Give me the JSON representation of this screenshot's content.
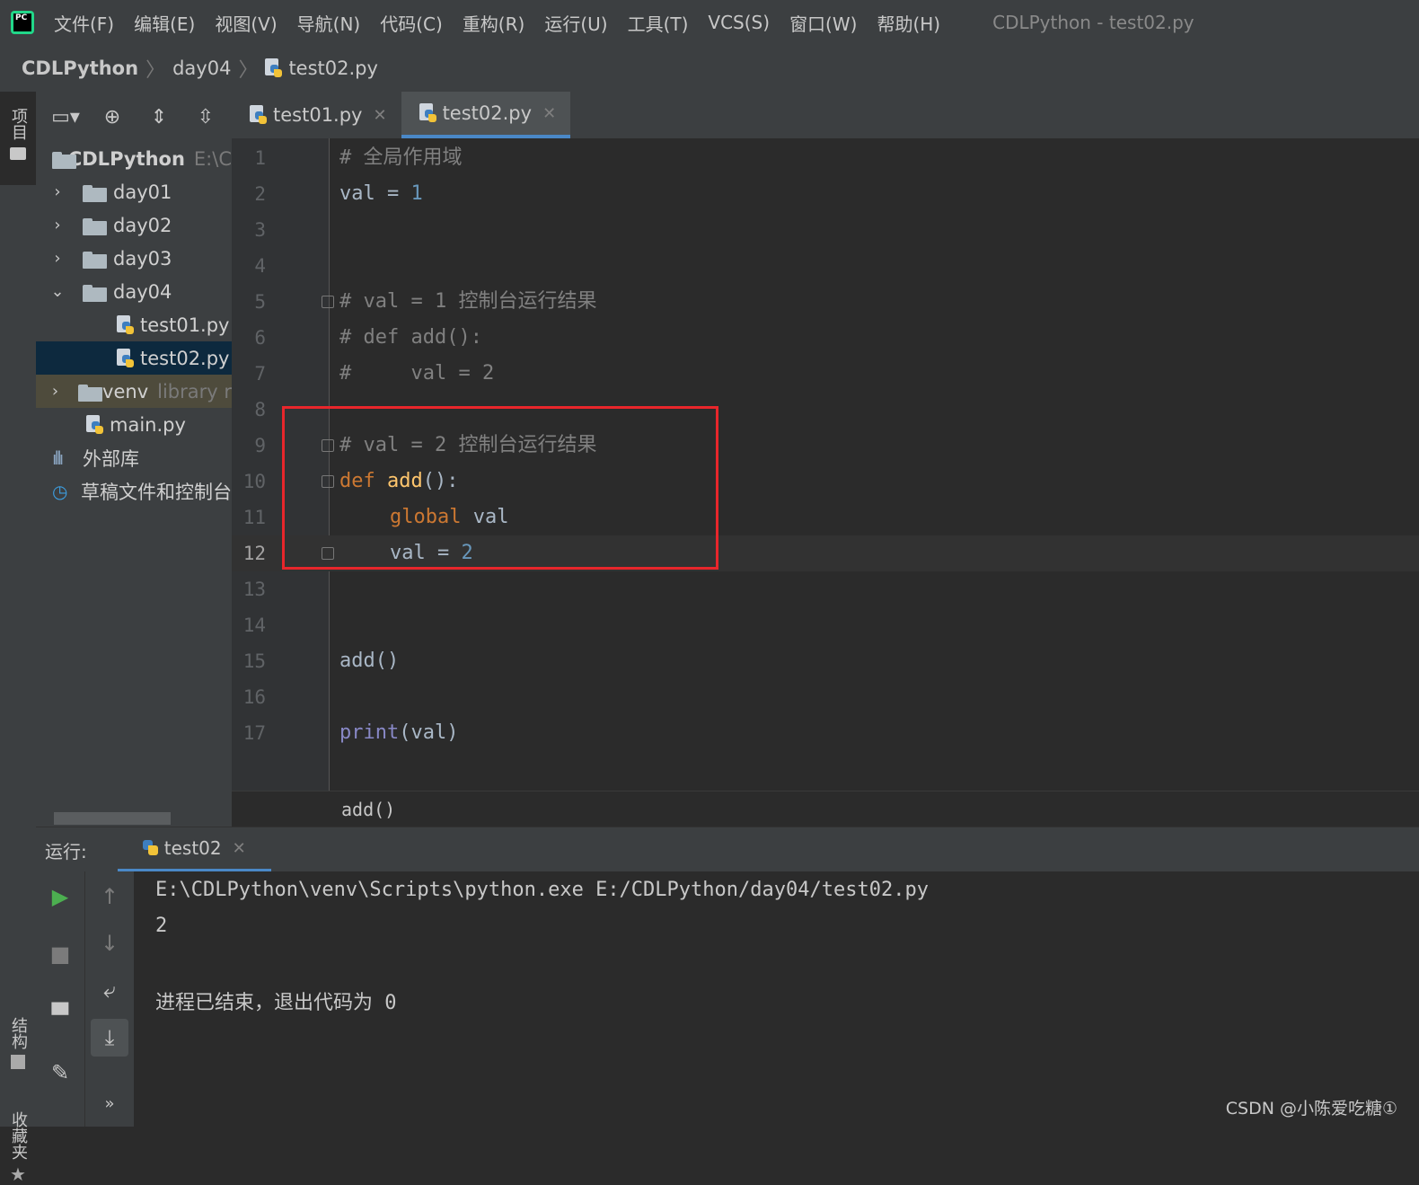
{
  "menu": {
    "items": [
      "文件(F)",
      "编辑(E)",
      "视图(V)",
      "导航(N)",
      "代码(C)",
      "重构(R)",
      "运行(U)",
      "工具(T)",
      "VCS(S)",
      "窗口(W)",
      "帮助(H)"
    ],
    "window_title": "CDLPython - test02.py"
  },
  "breadcrumb": {
    "project": "CDLPython",
    "folder": "day04",
    "file": "test02.py"
  },
  "stripe": {
    "project": "项目",
    "structure": "结构",
    "favorites": "收藏夹"
  },
  "project_panel": {
    "root_name": "CDLPython",
    "root_path": "E:\\C",
    "items": [
      {
        "label": "day01"
      },
      {
        "label": "day02"
      },
      {
        "label": "day03"
      },
      {
        "label": "day04"
      },
      {
        "label": "test01.py"
      },
      {
        "label": "test02.py"
      },
      {
        "label": "venv",
        "extra": "library r"
      },
      {
        "label": "main.py"
      },
      {
        "label": "外部库"
      },
      {
        "label": "草稿文件和控制台"
      }
    ]
  },
  "tabs": [
    {
      "label": "test01.py"
    },
    {
      "label": "test02.py",
      "active": true
    }
  ],
  "editor": {
    "line_numbers": [
      "1",
      "2",
      "3",
      "4",
      "5",
      "6",
      "7",
      "8",
      "9",
      "10",
      "11",
      "12",
      "13",
      "14",
      "15",
      "16",
      "17"
    ],
    "current_line": "12",
    "lines": {
      "l1": "# 全局作用域",
      "l2_a": "val = ",
      "l2_b": "1",
      "l5": "# val = 1 控制台运行结果",
      "l6": "# def add():",
      "l7": "#     val = 2",
      "l9": "# val = 2 控制台运行结果",
      "l10_kw": "def",
      "l10_fn": "add",
      "l10_rest": "():",
      "l11_kw": "global",
      "l11_rest": " val",
      "l12_a": "val = ",
      "l12_b": "2",
      "l15": "add()",
      "l17_fn": "print",
      "l17_rest": "(val)"
    },
    "crumb": "add()"
  },
  "run": {
    "label": "运行:",
    "tab": "test02",
    "console": [
      "E:\\CDLPython\\venv\\Scripts\\python.exe E:/CDLPython/day04/test02.py",
      "2",
      "进程已结束，退出代码为 0"
    ]
  },
  "watermark": "CSDN @小陈爱吃糖①",
  "colors": {
    "accent": "#4a88c7",
    "highlight_box": "#e8262b",
    "keyword": "#cc7832",
    "function": "#ffc66d",
    "number": "#6897bb",
    "comment": "#808080"
  }
}
